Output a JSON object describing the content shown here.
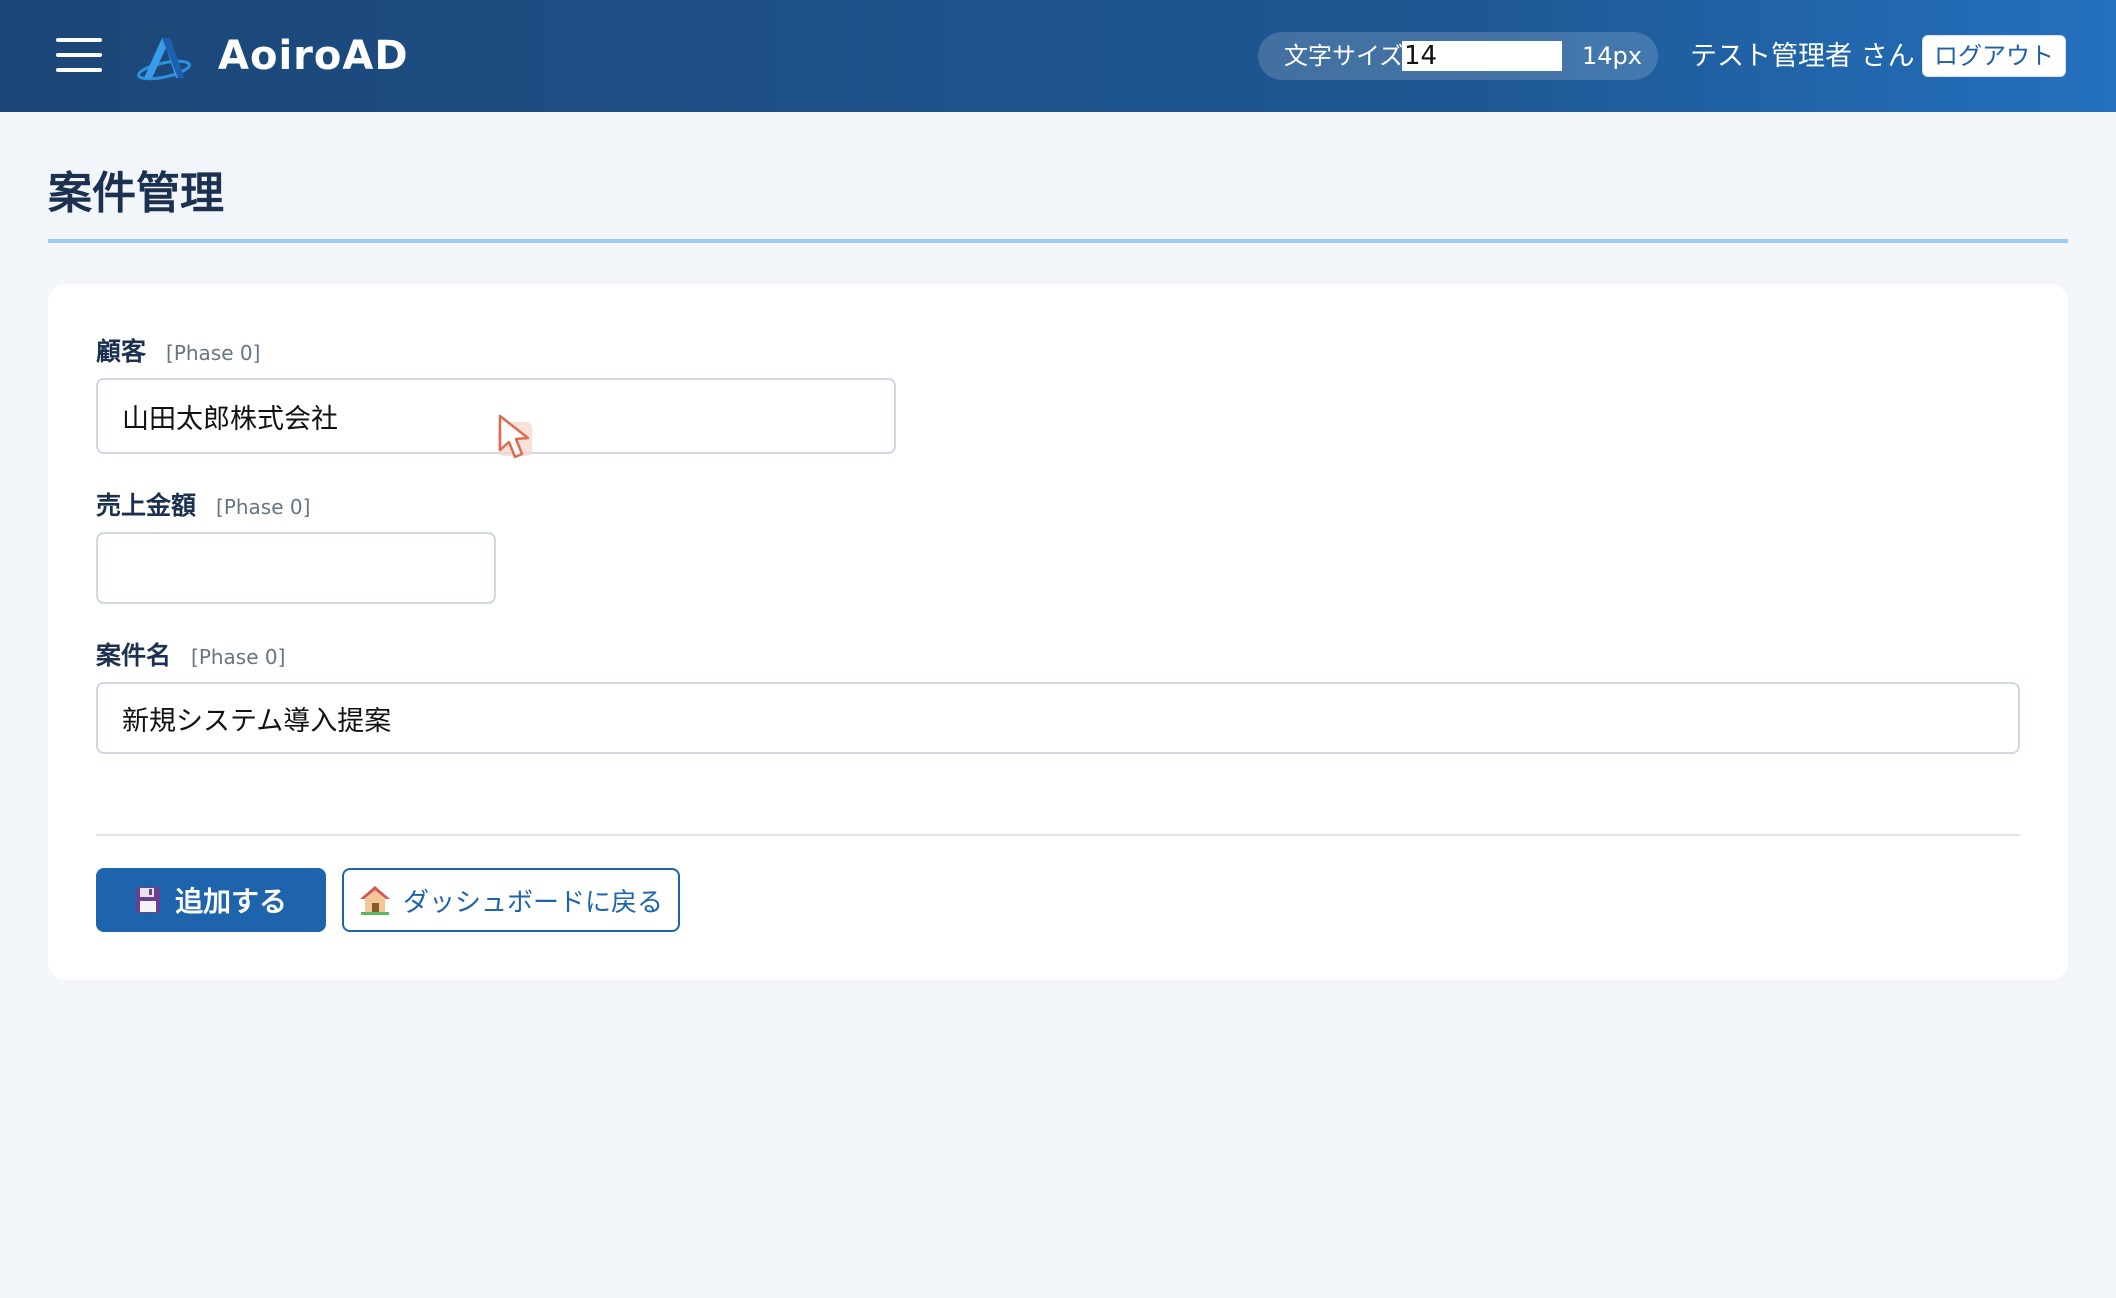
{
  "header": {
    "brand": "AoiroAD",
    "font_size_label": "文字サイズ",
    "font_size_value": "14",
    "font_size_unit": "14px",
    "username": "テスト管理者 さん",
    "logout_label": "ログアウト",
    "icons": {
      "menu": "hamburger-menu-icon",
      "logo": "aoiro-logo-icon"
    }
  },
  "page": {
    "title": "案件管理"
  },
  "form": {
    "customer": {
      "label": "顧客",
      "phase": "[Phase 0]",
      "value": "山田太郎株式会社"
    },
    "amount": {
      "label": "売上金額",
      "phase": "[Phase 0]",
      "value": ""
    },
    "project_name": {
      "label": "案件名",
      "phase": "[Phase 0]",
      "value": "新規システム導入提案"
    }
  },
  "actions": {
    "add_label": "追加する",
    "add_icon": "floppy-disk-icon",
    "back_label": "ダッシュボードに戻る",
    "back_icon": "house-icon"
  },
  "colors": {
    "header_start": "#1c4677",
    "header_end": "#2470bd",
    "primary": "#1e64ad",
    "title_text": "#1c3150",
    "title_rule": "#9ccdf0",
    "background": "#f2f6fa"
  }
}
